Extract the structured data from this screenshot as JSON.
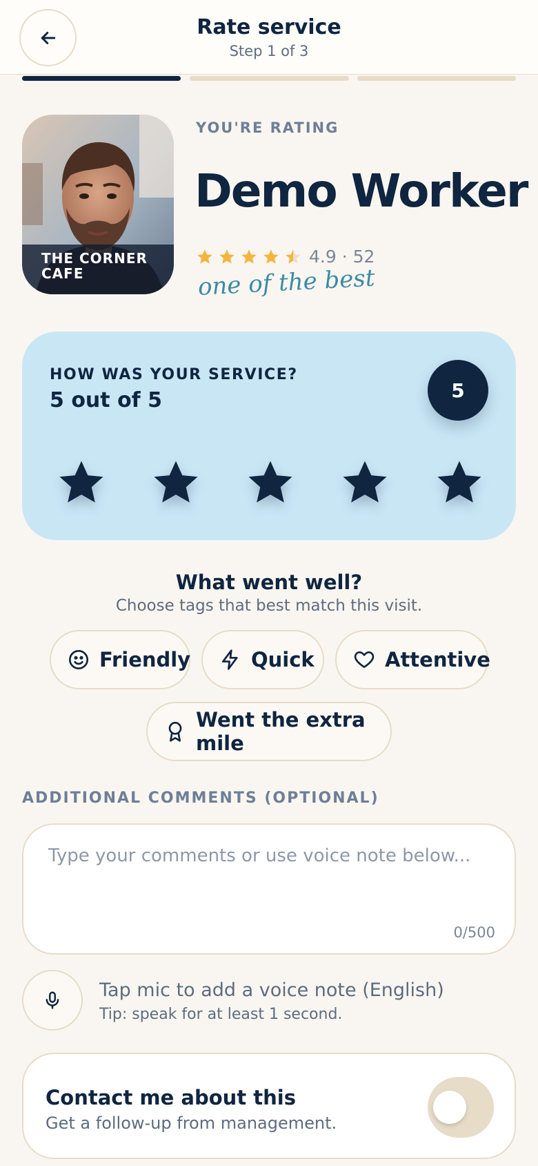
{
  "header": {
    "title": "Rate service",
    "step": "Step 1 of 3",
    "back_icon": "arrow-left-icon"
  },
  "progress": {
    "current_step": 1,
    "total_steps": 3
  },
  "worker": {
    "kicker": "YOU'RE RATING",
    "name": "Demo Worker",
    "workplace_line1": "THE CORNER",
    "workplace_line2": "CAFE",
    "rating_text": "4.9 · 52",
    "rating_value": 4.9,
    "tagline": "one of the best"
  },
  "service": {
    "question": "HOW WAS YOUR SERVICE?",
    "score_text": "5 out of 5",
    "score_badge": "5",
    "selected_stars": 5,
    "max_stars": 5
  },
  "went_well": {
    "title": "What went well?",
    "subtitle": "Choose tags that best match this visit.",
    "tags": [
      {
        "label": "Friendly",
        "icon": "smile-icon"
      },
      {
        "label": "Quick",
        "icon": "lightning-icon"
      },
      {
        "label": "Attentive",
        "icon": "heart-icon"
      },
      {
        "label": "Went the extra mile",
        "icon": "award-icon"
      }
    ]
  },
  "comments": {
    "label": "ADDITIONAL COMMENTS (OPTIONAL)",
    "placeholder": "Type your comments or use voice note below...",
    "value": "",
    "counter": "0/500"
  },
  "voice": {
    "main": "Tap mic to add a voice note (English)",
    "tip": "Tip: speak for at least 1 second.",
    "icon": "microphone-icon"
  },
  "contact": {
    "title": "Contact me about this",
    "subtitle": "Get a follow-up from management.",
    "enabled": false
  },
  "colors": {
    "navy": "#0f2540",
    "card_blue": "#c9e6f5",
    "star_gold": "#f4b53f",
    "beige": "#e6dcc8",
    "background": "#f9f6f1",
    "tagline_teal": "#3c8aa5"
  }
}
